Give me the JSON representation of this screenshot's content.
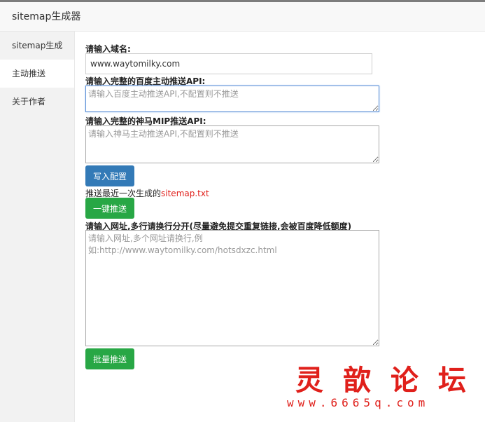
{
  "window": {
    "title": "sitemap生成器"
  },
  "sidebar": {
    "items": [
      {
        "label": "sitemap生成"
      },
      {
        "label": "主动推送"
      },
      {
        "label": "关于作者"
      }
    ]
  },
  "form": {
    "domain_label": "请输入域名:",
    "domain_value": "www.waytomilky.com",
    "baidu_label": "请输入完整的百度主动推送API:",
    "baidu_placeholder": "请输入百度主动推送API,不配置则不推送",
    "shenma_label": "请输入完整的神马MIP推送API:",
    "shenma_placeholder": "请输入神马主动推送API,不配置则不推送",
    "write_button": "写入配置",
    "push_note_prefix": "推送最近一次生成的",
    "push_note_link": "sitemap.txt",
    "one_click_button": "一键推送",
    "urls_label": "请输入网址,多行请换行分开(尽量避免提交重复链接,会被百度降低额度)",
    "urls_placeholder": "请输入网址,多个网址请换行,例\n如:http://www.waytomilky.com/hotsdxzc.html",
    "batch_button": "批量推送"
  },
  "watermark": {
    "title": "灵歆论坛",
    "url": "www.6665q.com"
  }
}
